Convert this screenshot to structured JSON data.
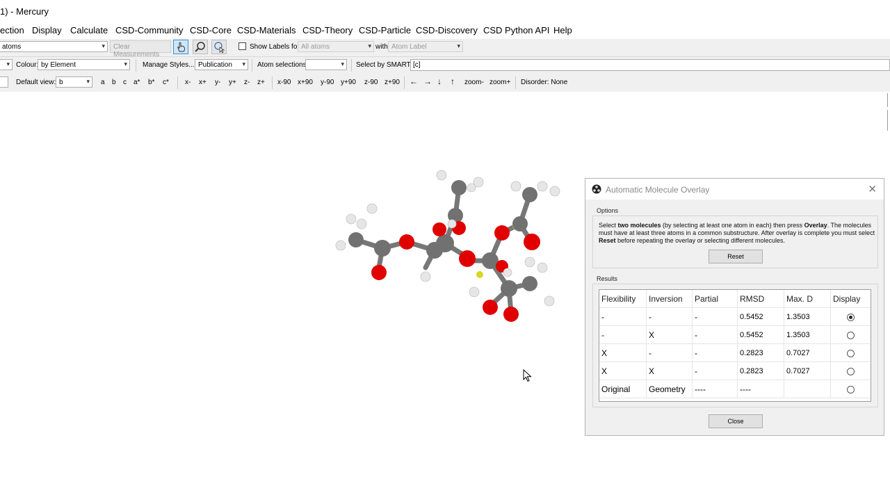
{
  "window": {
    "title": "1) - Mercury"
  },
  "menu": [
    "ection",
    "Display",
    "Calculate",
    "CSD-Community",
    "CSD-Core",
    "CSD-Materials",
    "CSD-Theory",
    "CSD-Particle",
    "CSD-Discovery",
    "CSD Python API",
    "Help"
  ],
  "toolbar1": {
    "atoms_combo": "atoms",
    "clear_measurements": "Clear Measurements",
    "show_labels_for": "Show Labels for",
    "labels_target": "All atoms",
    "with": "with",
    "label_type": "Atom Label"
  },
  "toolbar2": {
    "colour_label": "Colour:",
    "colour_value": "by Element",
    "manage_styles": "Manage Styles...",
    "style_value": "Publication",
    "atom_selections": "Atom selections:",
    "select_by_smarts": "Select by SMARTS:",
    "smarts_value": "[c]"
  },
  "toolbar3": {
    "default_view_label": "Default view:",
    "default_view_value": "b",
    "axes": [
      "a",
      "b",
      "c",
      "a*",
      "b*",
      "c*"
    ],
    "rotations": [
      "x-",
      "x+",
      "y-",
      "y+",
      "z-",
      "z+"
    ],
    "rot90": [
      "x-90",
      "x+90",
      "y-90",
      "y+90",
      "z-90",
      "z+90"
    ],
    "arrows": [
      "←",
      "→",
      "↓",
      "↑"
    ],
    "zoom": [
      "zoom-",
      "zoom+"
    ],
    "disorder": "Disorder: None"
  },
  "dialog": {
    "title": "Automatic Molecule Overlay",
    "options_label": "Options",
    "instructions_1": "Select ",
    "instructions_bold1": "two molecules",
    "instructions_2": " (by selecting at least one atom in each) then press ",
    "instructions_bold2": "Overlay",
    "instructions_3": ". The molecules must have at least three atoms in a common substructure. After overlay is complete you must select ",
    "instructions_bold3": "Reset",
    "instructions_4": " before repeating the overlay or selecting different molecules.",
    "reset_button": "Reset",
    "results_label": "Results",
    "columns": [
      "Flexibility",
      "Inversion",
      "Partial",
      "RMSD",
      "Max. D",
      "Display"
    ],
    "rows": [
      {
        "flex": "-",
        "inv": "-",
        "partial": "-",
        "rmsd": "0.5452",
        "maxd": "1.3503",
        "selected": true
      },
      {
        "flex": "-",
        "inv": "X",
        "partial": "-",
        "rmsd": "0.5452",
        "maxd": "1.3503",
        "selected": false
      },
      {
        "flex": "X",
        "inv": "-",
        "partial": "-",
        "rmsd": "0.2823",
        "maxd": "0.7027",
        "selected": false
      },
      {
        "flex": "X",
        "inv": "X",
        "partial": "-",
        "rmsd": "0.2823",
        "maxd": "0.7027",
        "selected": false
      },
      {
        "flex": "Original",
        "inv": "Geometry",
        "partial": "----",
        "rmsd": "----",
        "maxd": "",
        "selected": false
      }
    ],
    "close_button": "Close"
  },
  "colors": {
    "oxygen": "#e00000",
    "carbon": "#707070",
    "hydrogen": "#e8e8e8",
    "selection": "#d8d820"
  }
}
